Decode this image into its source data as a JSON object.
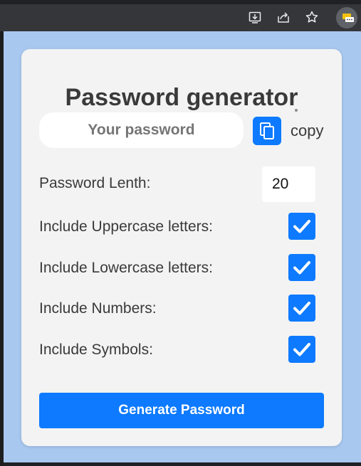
{
  "browser": {
    "icons": [
      "install-icon",
      "share-icon",
      "bookmark-star-icon",
      "extension-icon"
    ]
  },
  "popup": {
    "title": "Password generator",
    "password_field": {
      "placeholder": "Your password",
      "value": ""
    },
    "copy_label": "copy",
    "length": {
      "label": "Password Lenth:",
      "value": "20"
    },
    "options": [
      {
        "label": "Include Uppercase letters:",
        "checked": true
      },
      {
        "label": "Include Lowercase letters:",
        "checked": true
      },
      {
        "label": "Include Numbers:",
        "checked": true
      },
      {
        "label": "Include Symbols:",
        "checked": true
      }
    ],
    "generate_label": "Generate Password"
  },
  "colors": {
    "accent": "#0d7aff",
    "popup_background": "#a8c8f0",
    "card_background": "#f3f3f3",
    "text": "#3a3a3a"
  }
}
